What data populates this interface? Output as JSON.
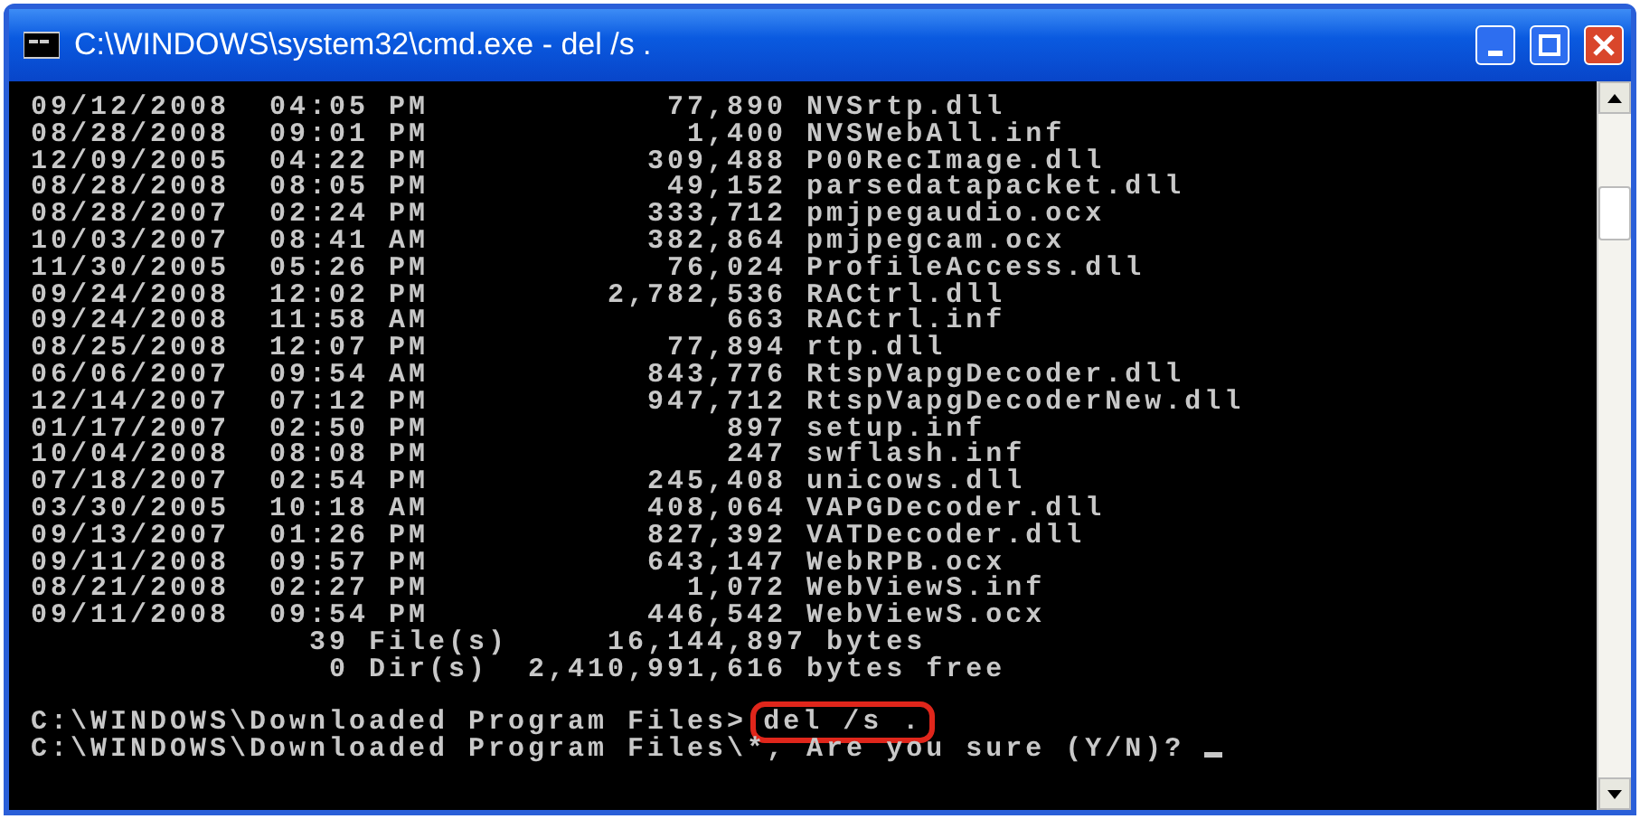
{
  "window": {
    "title": "C:\\WINDOWS\\system32\\cmd.exe - del /s ."
  },
  "files": [
    {
      "date": "09/12/2008",
      "time": "04:05 PM",
      "size": "77,890",
      "name": "NVSrtp.dll"
    },
    {
      "date": "08/28/2008",
      "time": "09:01 PM",
      "size": "1,400",
      "name": "NVSWebAll.inf"
    },
    {
      "date": "12/09/2005",
      "time": "04:22 PM",
      "size": "309,488",
      "name": "P00RecImage.dll"
    },
    {
      "date": "08/28/2008",
      "time": "08:05 PM",
      "size": "49,152",
      "name": "parsedatapacket.dll"
    },
    {
      "date": "08/28/2007",
      "time": "02:24 PM",
      "size": "333,712",
      "name": "pmjpegaudio.ocx"
    },
    {
      "date": "10/03/2007",
      "time": "08:41 AM",
      "size": "382,864",
      "name": "pmjpegcam.ocx"
    },
    {
      "date": "11/30/2005",
      "time": "05:26 PM",
      "size": "76,024",
      "name": "ProfileAccess.dll"
    },
    {
      "date": "09/24/2008",
      "time": "12:02 PM",
      "size": "2,782,536",
      "name": "RACtrl.dll"
    },
    {
      "date": "09/24/2008",
      "time": "11:58 AM",
      "size": "663",
      "name": "RACtrl.inf"
    },
    {
      "date": "08/25/2008",
      "time": "12:07 PM",
      "size": "77,894",
      "name": "rtp.dll"
    },
    {
      "date": "06/06/2007",
      "time": "09:54 AM",
      "size": "843,776",
      "name": "RtspVapgDecoder.dll"
    },
    {
      "date": "12/14/2007",
      "time": "07:12 PM",
      "size": "947,712",
      "name": "RtspVapgDecoderNew.dll"
    },
    {
      "date": "01/17/2007",
      "time": "02:50 PM",
      "size": "897",
      "name": "setup.inf"
    },
    {
      "date": "10/04/2008",
      "time": "08:08 PM",
      "size": "247",
      "name": "swflash.inf"
    },
    {
      "date": "07/18/2007",
      "time": "02:54 PM",
      "size": "245,408",
      "name": "unicows.dll"
    },
    {
      "date": "03/30/2005",
      "time": "10:18 AM",
      "size": "408,064",
      "name": "VAPGDecoder.dll"
    },
    {
      "date": "09/13/2007",
      "time": "01:26 PM",
      "size": "827,392",
      "name": "VATDecoder.dll"
    },
    {
      "date": "09/11/2008",
      "time": "09:57 PM",
      "size": "643,147",
      "name": "WebRPB.ocx"
    },
    {
      "date": "08/21/2008",
      "time": "02:27 PM",
      "size": "1,072",
      "name": "WebViewS.inf"
    },
    {
      "date": "09/11/2008",
      "time": "09:54 PM",
      "size": "446,542",
      "name": "WebViewS.ocx"
    }
  ],
  "summary": [
    "              39 File(s)     16,144,897 bytes",
    "               0 Dir(s)  2,410,991,616 bytes free"
  ],
  "prompts": [
    {
      "prompt": "C:\\WINDOWS\\Downloaded Program Files>",
      "command": "del /s .",
      "highlighted": true
    },
    {
      "prompt": "C:\\WINDOWS\\Downloaded Program Files\\*, Are you sure (Y/N)?",
      "cursor": true
    }
  ]
}
